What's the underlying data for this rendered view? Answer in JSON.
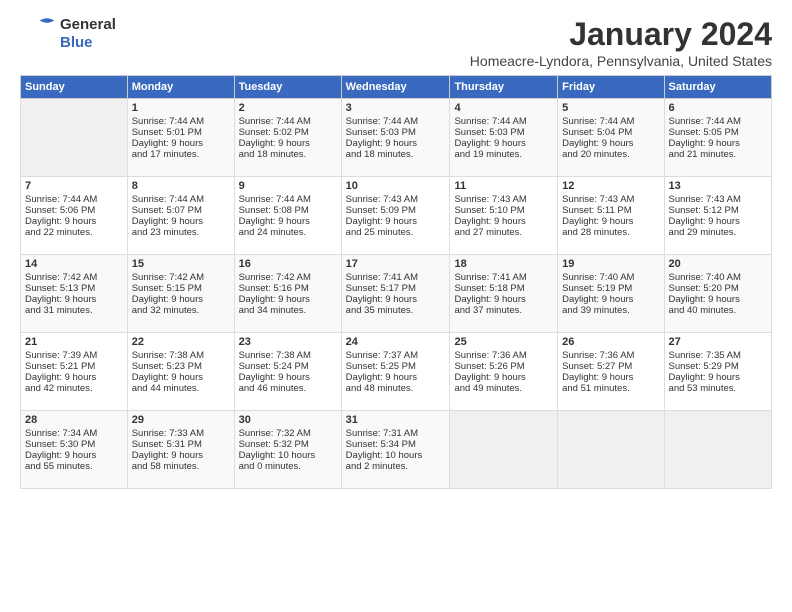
{
  "logo": {
    "line1": "General",
    "line2": "Blue"
  },
  "title": "January 2024",
  "subtitle": "Homeacre-Lyndora, Pennsylvania, United States",
  "days_header": [
    "Sunday",
    "Monday",
    "Tuesday",
    "Wednesday",
    "Thursday",
    "Friday",
    "Saturday"
  ],
  "weeks": [
    [
      {
        "num": "",
        "lines": []
      },
      {
        "num": "1",
        "lines": [
          "Sunrise: 7:44 AM",
          "Sunset: 5:01 PM",
          "Daylight: 9 hours",
          "and 17 minutes."
        ]
      },
      {
        "num": "2",
        "lines": [
          "Sunrise: 7:44 AM",
          "Sunset: 5:02 PM",
          "Daylight: 9 hours",
          "and 18 minutes."
        ]
      },
      {
        "num": "3",
        "lines": [
          "Sunrise: 7:44 AM",
          "Sunset: 5:03 PM",
          "Daylight: 9 hours",
          "and 18 minutes."
        ]
      },
      {
        "num": "4",
        "lines": [
          "Sunrise: 7:44 AM",
          "Sunset: 5:03 PM",
          "Daylight: 9 hours",
          "and 19 minutes."
        ]
      },
      {
        "num": "5",
        "lines": [
          "Sunrise: 7:44 AM",
          "Sunset: 5:04 PM",
          "Daylight: 9 hours",
          "and 20 minutes."
        ]
      },
      {
        "num": "6",
        "lines": [
          "Sunrise: 7:44 AM",
          "Sunset: 5:05 PM",
          "Daylight: 9 hours",
          "and 21 minutes."
        ]
      }
    ],
    [
      {
        "num": "7",
        "lines": [
          "Sunrise: 7:44 AM",
          "Sunset: 5:06 PM",
          "Daylight: 9 hours",
          "and 22 minutes."
        ]
      },
      {
        "num": "8",
        "lines": [
          "Sunrise: 7:44 AM",
          "Sunset: 5:07 PM",
          "Daylight: 9 hours",
          "and 23 minutes."
        ]
      },
      {
        "num": "9",
        "lines": [
          "Sunrise: 7:44 AM",
          "Sunset: 5:08 PM",
          "Daylight: 9 hours",
          "and 24 minutes."
        ]
      },
      {
        "num": "10",
        "lines": [
          "Sunrise: 7:43 AM",
          "Sunset: 5:09 PM",
          "Daylight: 9 hours",
          "and 25 minutes."
        ]
      },
      {
        "num": "11",
        "lines": [
          "Sunrise: 7:43 AM",
          "Sunset: 5:10 PM",
          "Daylight: 9 hours",
          "and 27 minutes."
        ]
      },
      {
        "num": "12",
        "lines": [
          "Sunrise: 7:43 AM",
          "Sunset: 5:11 PM",
          "Daylight: 9 hours",
          "and 28 minutes."
        ]
      },
      {
        "num": "13",
        "lines": [
          "Sunrise: 7:43 AM",
          "Sunset: 5:12 PM",
          "Daylight: 9 hours",
          "and 29 minutes."
        ]
      }
    ],
    [
      {
        "num": "14",
        "lines": [
          "Sunrise: 7:42 AM",
          "Sunset: 5:13 PM",
          "Daylight: 9 hours",
          "and 31 minutes."
        ]
      },
      {
        "num": "15",
        "lines": [
          "Sunrise: 7:42 AM",
          "Sunset: 5:15 PM",
          "Daylight: 9 hours",
          "and 32 minutes."
        ]
      },
      {
        "num": "16",
        "lines": [
          "Sunrise: 7:42 AM",
          "Sunset: 5:16 PM",
          "Daylight: 9 hours",
          "and 34 minutes."
        ]
      },
      {
        "num": "17",
        "lines": [
          "Sunrise: 7:41 AM",
          "Sunset: 5:17 PM",
          "Daylight: 9 hours",
          "and 35 minutes."
        ]
      },
      {
        "num": "18",
        "lines": [
          "Sunrise: 7:41 AM",
          "Sunset: 5:18 PM",
          "Daylight: 9 hours",
          "and 37 minutes."
        ]
      },
      {
        "num": "19",
        "lines": [
          "Sunrise: 7:40 AM",
          "Sunset: 5:19 PM",
          "Daylight: 9 hours",
          "and 39 minutes."
        ]
      },
      {
        "num": "20",
        "lines": [
          "Sunrise: 7:40 AM",
          "Sunset: 5:20 PM",
          "Daylight: 9 hours",
          "and 40 minutes."
        ]
      }
    ],
    [
      {
        "num": "21",
        "lines": [
          "Sunrise: 7:39 AM",
          "Sunset: 5:21 PM",
          "Daylight: 9 hours",
          "and 42 minutes."
        ]
      },
      {
        "num": "22",
        "lines": [
          "Sunrise: 7:38 AM",
          "Sunset: 5:23 PM",
          "Daylight: 9 hours",
          "and 44 minutes."
        ]
      },
      {
        "num": "23",
        "lines": [
          "Sunrise: 7:38 AM",
          "Sunset: 5:24 PM",
          "Daylight: 9 hours",
          "and 46 minutes."
        ]
      },
      {
        "num": "24",
        "lines": [
          "Sunrise: 7:37 AM",
          "Sunset: 5:25 PM",
          "Daylight: 9 hours",
          "and 48 minutes."
        ]
      },
      {
        "num": "25",
        "lines": [
          "Sunrise: 7:36 AM",
          "Sunset: 5:26 PM",
          "Daylight: 9 hours",
          "and 49 minutes."
        ]
      },
      {
        "num": "26",
        "lines": [
          "Sunrise: 7:36 AM",
          "Sunset: 5:27 PM",
          "Daylight: 9 hours",
          "and 51 minutes."
        ]
      },
      {
        "num": "27",
        "lines": [
          "Sunrise: 7:35 AM",
          "Sunset: 5:29 PM",
          "Daylight: 9 hours",
          "and 53 minutes."
        ]
      }
    ],
    [
      {
        "num": "28",
        "lines": [
          "Sunrise: 7:34 AM",
          "Sunset: 5:30 PM",
          "Daylight: 9 hours",
          "and 55 minutes."
        ]
      },
      {
        "num": "29",
        "lines": [
          "Sunrise: 7:33 AM",
          "Sunset: 5:31 PM",
          "Daylight: 9 hours",
          "and 58 minutes."
        ]
      },
      {
        "num": "30",
        "lines": [
          "Sunrise: 7:32 AM",
          "Sunset: 5:32 PM",
          "Daylight: 10 hours",
          "and 0 minutes."
        ]
      },
      {
        "num": "31",
        "lines": [
          "Sunrise: 7:31 AM",
          "Sunset: 5:34 PM",
          "Daylight: 10 hours",
          "and 2 minutes."
        ]
      },
      {
        "num": "",
        "lines": []
      },
      {
        "num": "",
        "lines": []
      },
      {
        "num": "",
        "lines": []
      }
    ]
  ]
}
